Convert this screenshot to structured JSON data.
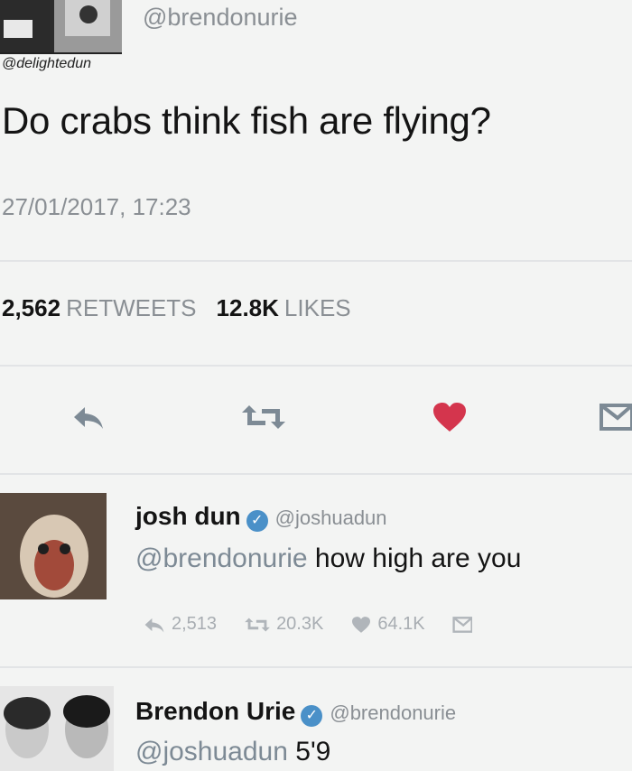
{
  "top": {
    "handle": "@brendonurie",
    "caption_handle": "@delightedun"
  },
  "tweet": {
    "text": "Do crabs think fish are flying?",
    "timestamp": "27/01/2017, 17:23",
    "retweets_count": "2,562",
    "retweets_label": "RETWEETS",
    "likes_count": "12.8K",
    "likes_label": "LIKES"
  },
  "actions": {
    "reply_icon": "reply-icon",
    "retweet_icon": "retweet-icon",
    "like_icon": "heart-icon",
    "dm_icon": "envelope-icon",
    "like_color": "#d4354d"
  },
  "replies": [
    {
      "name": "josh dun",
      "handle": "@joshuadun",
      "mention": "@brendonurie",
      "text": "how high are you",
      "reply_count": "2,513",
      "retweet_count": "20.3K",
      "like_count": "64.1K"
    },
    {
      "name": "Brendon Urie",
      "handle": "@brendonurie",
      "mention": "@joshuadun",
      "text": "5'9"
    }
  ],
  "colors": {
    "text_primary": "#141414",
    "text_secondary": "#8a8f94",
    "verified": "#4a90c8"
  }
}
